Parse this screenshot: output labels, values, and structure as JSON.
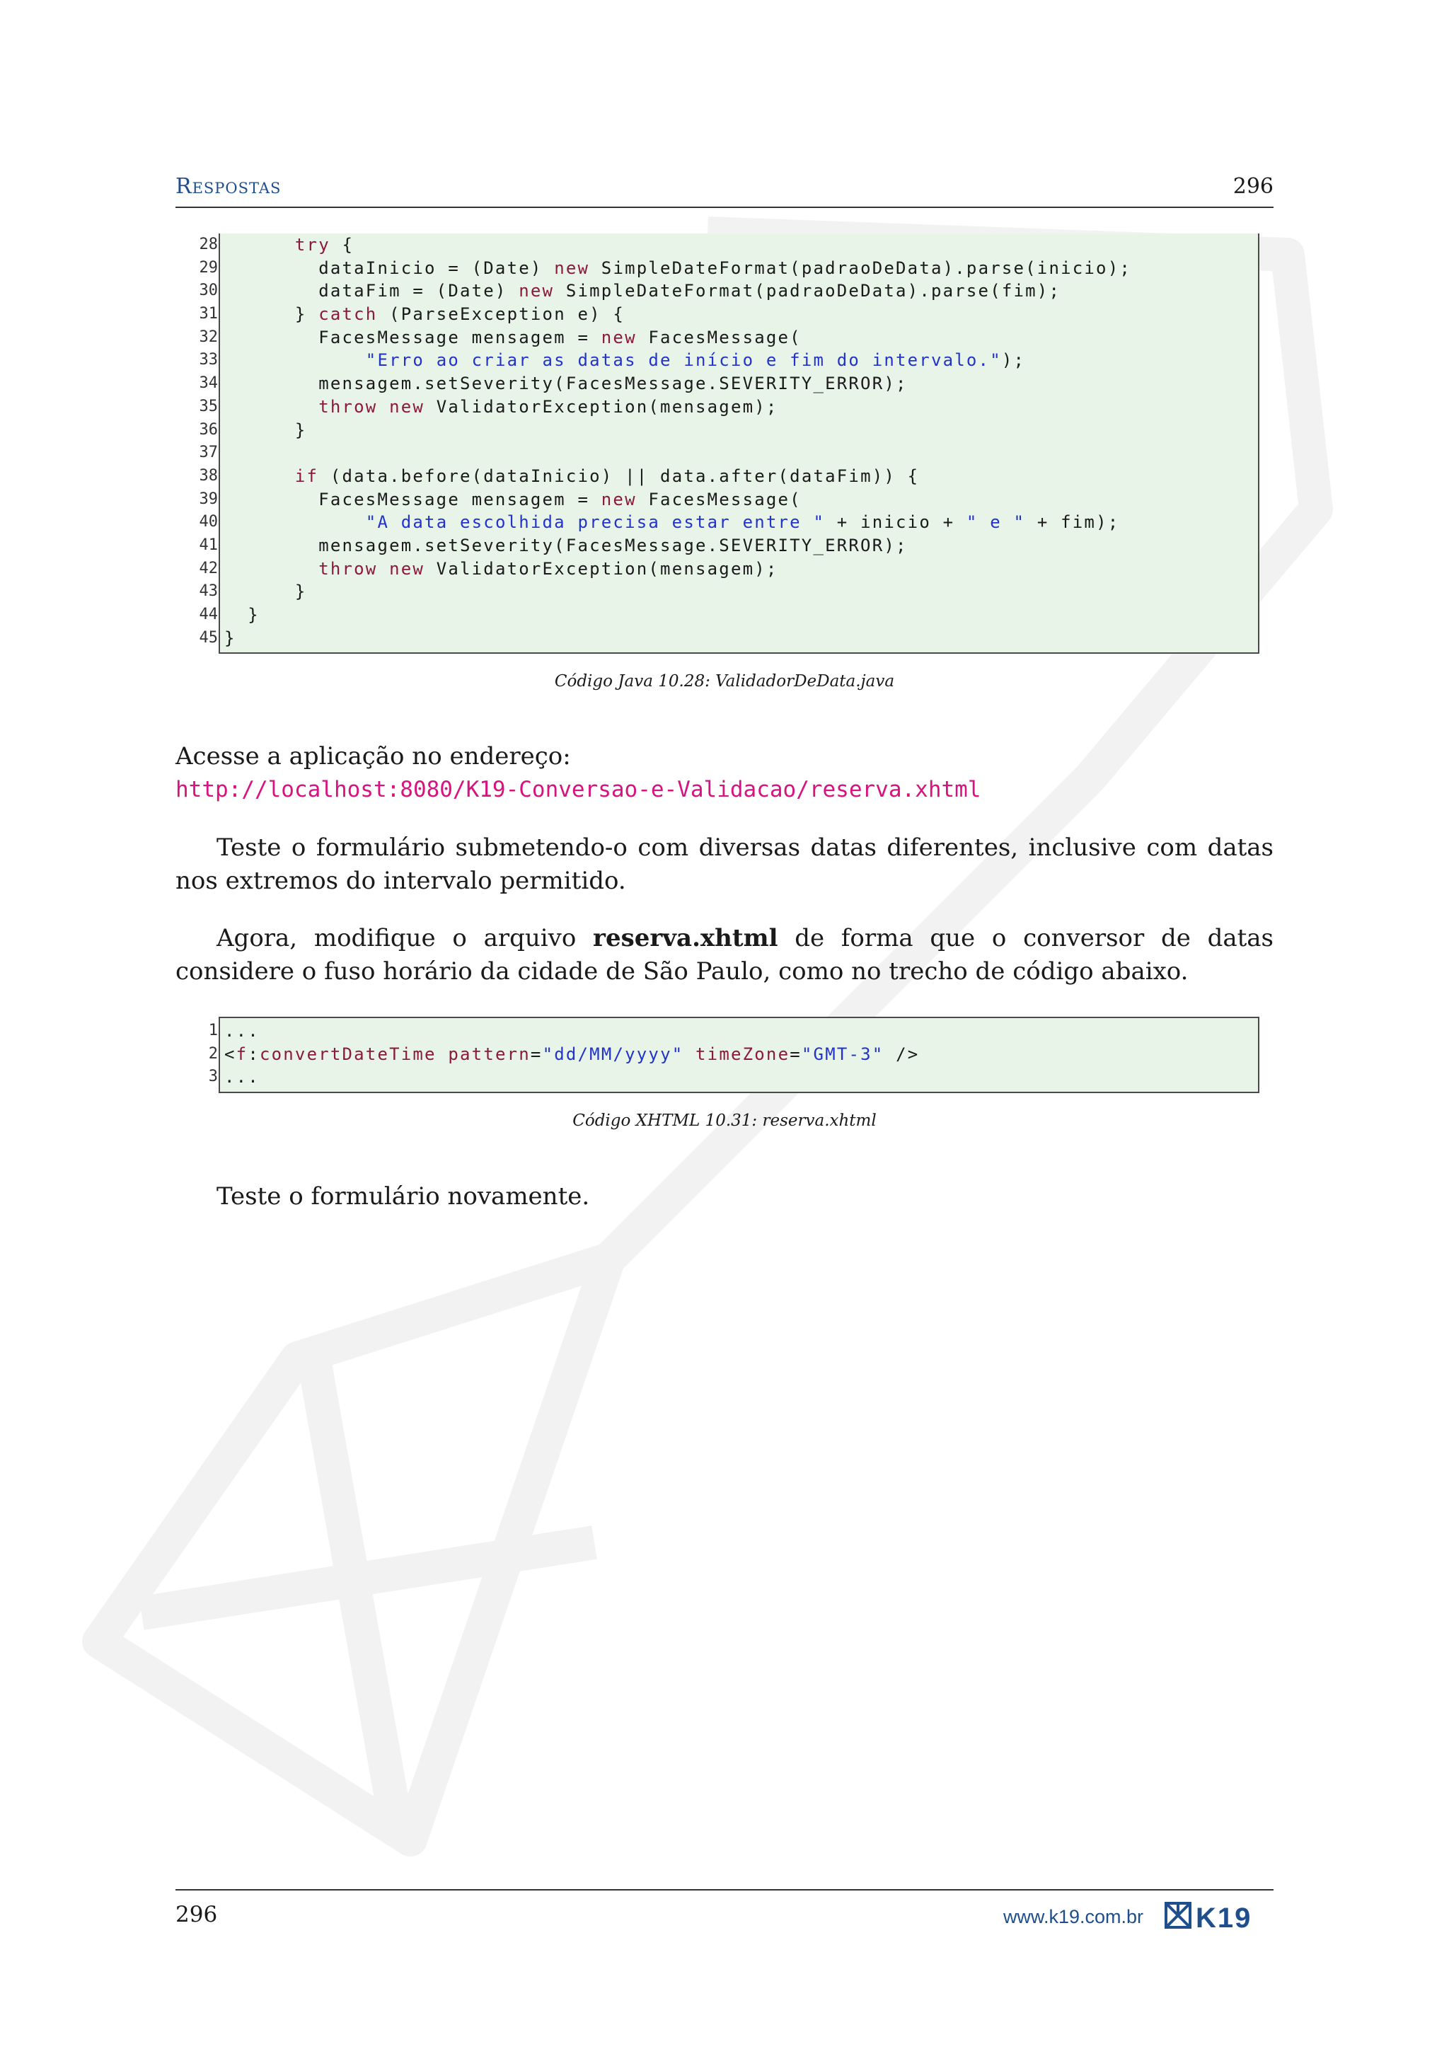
{
  "header": {
    "section": "Respostas",
    "page_number": "296"
  },
  "code_block_1": {
    "lines": [
      {
        "n": "28",
        "segs": [
          {
            "t": "      "
          },
          {
            "t": "try",
            "c": "kw"
          },
          {
            "t": " {"
          }
        ]
      },
      {
        "n": "29",
        "segs": [
          {
            "t": "        dataInicio = (Date) "
          },
          {
            "t": "new",
            "c": "kw"
          },
          {
            "t": " SimpleDateFormat(padraoDeData).parse(inicio);"
          }
        ]
      },
      {
        "n": "30",
        "segs": [
          {
            "t": "        dataFim = (Date) "
          },
          {
            "t": "new",
            "c": "kw"
          },
          {
            "t": " SimpleDateFormat(padraoDeData).parse(fim);"
          }
        ]
      },
      {
        "n": "31",
        "segs": [
          {
            "t": "      } "
          },
          {
            "t": "catch",
            "c": "kw"
          },
          {
            "t": " (ParseException e) {"
          }
        ]
      },
      {
        "n": "32",
        "segs": [
          {
            "t": "        FacesMessage mensagem = "
          },
          {
            "t": "new",
            "c": "kw"
          },
          {
            "t": " FacesMessage("
          }
        ]
      },
      {
        "n": "33",
        "segs": [
          {
            "t": "            "
          },
          {
            "t": "\"Erro ao criar as datas de início e fim do intervalo.\"",
            "c": "str"
          },
          {
            "t": ");"
          }
        ]
      },
      {
        "n": "34",
        "segs": [
          {
            "t": "        mensagem.setSeverity(FacesMessage.SEVERITY_ERROR);"
          }
        ]
      },
      {
        "n": "35",
        "segs": [
          {
            "t": "        "
          },
          {
            "t": "throw",
            "c": "kw"
          },
          {
            "t": " "
          },
          {
            "t": "new",
            "c": "kw"
          },
          {
            "t": " ValidatorException(mensagem);"
          }
        ]
      },
      {
        "n": "36",
        "segs": [
          {
            "t": "      }"
          }
        ]
      },
      {
        "n": "37",
        "segs": [
          {
            "t": ""
          }
        ]
      },
      {
        "n": "38",
        "segs": [
          {
            "t": "      "
          },
          {
            "t": "if",
            "c": "kw"
          },
          {
            "t": " (data.before(dataInicio) || data.after(dataFim)) {"
          }
        ]
      },
      {
        "n": "39",
        "segs": [
          {
            "t": "        FacesMessage mensagem = "
          },
          {
            "t": "new",
            "c": "kw"
          },
          {
            "t": " FacesMessage("
          }
        ]
      },
      {
        "n": "40",
        "segs": [
          {
            "t": "            "
          },
          {
            "t": "\"A data escolhida precisa estar entre \"",
            "c": "str"
          },
          {
            "t": " + inicio + "
          },
          {
            "t": "\" e \"",
            "c": "str"
          },
          {
            "t": " + fim);"
          }
        ]
      },
      {
        "n": "41",
        "segs": [
          {
            "t": "        mensagem.setSeverity(FacesMessage.SEVERITY_ERROR);"
          }
        ]
      },
      {
        "n": "42",
        "segs": [
          {
            "t": "        "
          },
          {
            "t": "throw",
            "c": "kw"
          },
          {
            "t": " "
          },
          {
            "t": "new",
            "c": "kw"
          },
          {
            "t": " ValidatorException(mensagem);"
          }
        ]
      },
      {
        "n": "43",
        "segs": [
          {
            "t": "      }"
          }
        ]
      },
      {
        "n": "44",
        "segs": [
          {
            "t": "  }"
          }
        ]
      },
      {
        "n": "45",
        "segs": [
          {
            "t": "}"
          }
        ]
      }
    ],
    "caption": "Código Java 10.28: ValidadorDeData.java"
  },
  "text": {
    "p1_line1": "Acesse a aplicação no endereço:",
    "p1_url": "http://localhost:8080/K19-Conversao-e-Validacao/reserva.xhtml",
    "p2": "Teste o formulário submetendo-o com diversas datas diferentes, inclusive com datas nos extremos do intervalo permitido.",
    "p3_before": "Agora, modifique o arquivo ",
    "p3_bold": "reserva.xhtml",
    "p3_after": " de forma que o conversor de datas considere o fuso horário da cidade de São Paulo, como no trecho de código abaixo.",
    "p4": "Teste o formulário novamente."
  },
  "code_block_2": {
    "lines": [
      {
        "n": "1",
        "segs": [
          {
            "t": "..."
          }
        ]
      },
      {
        "n": "2",
        "segs": [
          {
            "t": "<"
          },
          {
            "t": "f",
            "c": "tag"
          },
          {
            "t": ":"
          },
          {
            "t": "convertDateTime",
            "c": "tag"
          },
          {
            "t": " "
          },
          {
            "t": "pattern",
            "c": "tag"
          },
          {
            "t": "="
          },
          {
            "t": "\"dd/MM/yyyy\"",
            "c": "str"
          },
          {
            "t": " "
          },
          {
            "t": "timeZone",
            "c": "tag"
          },
          {
            "t": "="
          },
          {
            "t": "\"GMT-3\"",
            "c": "str"
          },
          {
            "t": " />"
          }
        ]
      },
      {
        "n": "3",
        "segs": [
          {
            "t": "..."
          }
        ]
      }
    ],
    "caption": "Código XHTML 10.31: reserva.xhtml"
  },
  "footer": {
    "page_number": "296",
    "site": "www.k19.com.br",
    "logo_text": "K19"
  }
}
